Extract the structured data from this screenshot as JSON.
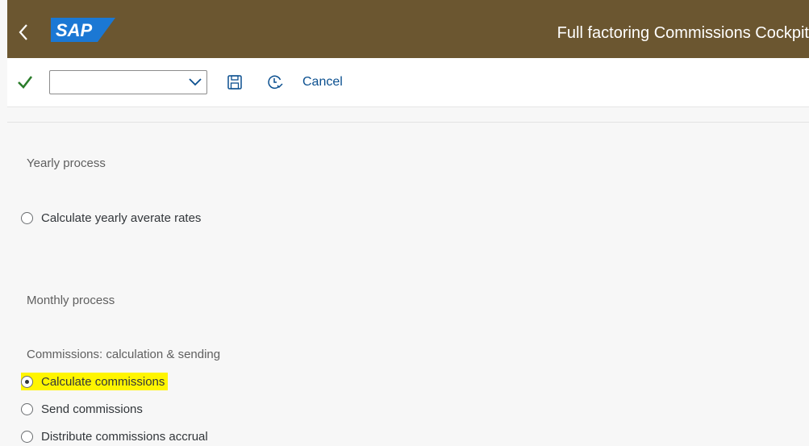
{
  "header": {
    "logo_text": "SAP",
    "title": "Full factoring Commissions Cockpit",
    "colors": {
      "background": "#6b5630",
      "logo_blue": "#1b78d4"
    }
  },
  "toolbar": {
    "variant_select": {
      "value": "",
      "placeholder": ""
    },
    "cancel_label": "Cancel",
    "icons": [
      "checkmark-icon",
      "chevron-down-icon",
      "save-icon",
      "clock-icon"
    ]
  },
  "sections": {
    "yearly": {
      "label": "Yearly process",
      "options": [
        {
          "label": "Calculate yearly averate rates",
          "selected": false
        }
      ]
    },
    "monthly": {
      "label": "Monthly process",
      "sublabel": "Commissions: calculation & sending",
      "options": [
        {
          "label": "Calculate commissions",
          "selected": true,
          "highlighted": true
        },
        {
          "label": "Send commissions",
          "selected": false
        },
        {
          "label": "Distribute commissions accrual",
          "selected": false
        }
      ]
    }
  }
}
